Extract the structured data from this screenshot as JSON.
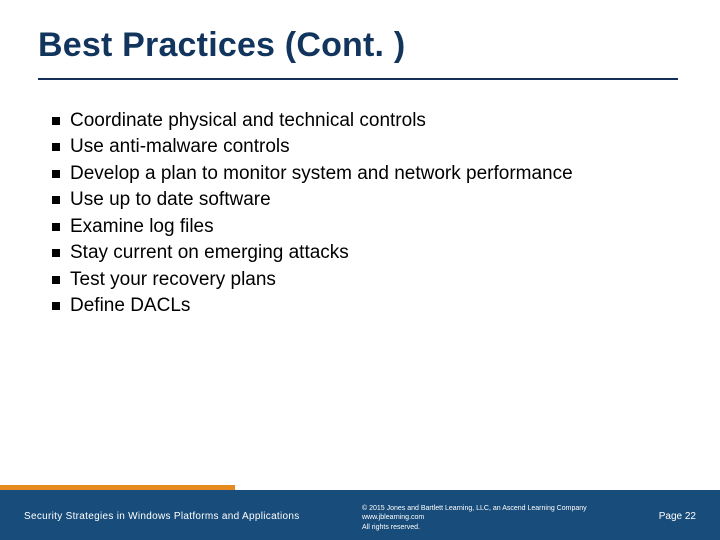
{
  "title": "Best Practices (Cont. )",
  "bullets": [
    "Coordinate physical and technical controls",
    "Use anti-malware controls",
    "Develop a plan to monitor system and network performance",
    "Use up to date software",
    "Examine log files",
    "Stay current on emerging attacks",
    "Test your recovery plans",
    "Define DACLs"
  ],
  "footer": {
    "left": "Security Strategies in Windows Platforms and Applications",
    "center_line1": "© 2015 Jones and Bartlett Learning, LLC, an Ascend Learning Company",
    "center_line2": "www.jblearning.com",
    "center_line3": "All rights reserved.",
    "right": "Page 22"
  }
}
